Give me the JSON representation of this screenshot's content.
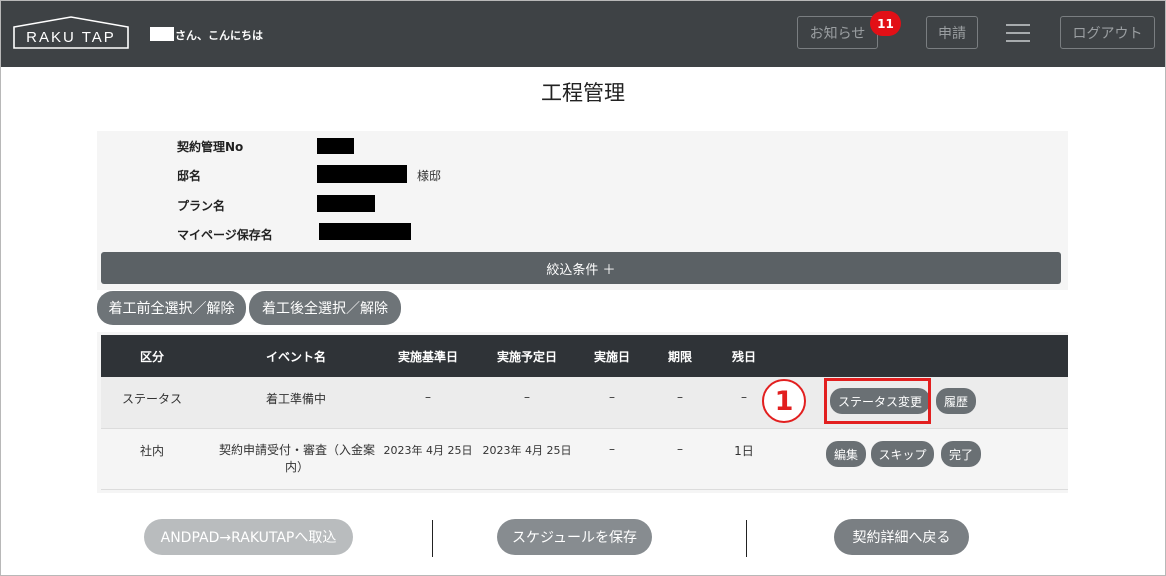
{
  "header": {
    "logo_text": "RAKU TAP",
    "greeting": "さん、こんにちは",
    "notice_label": "お知らせ",
    "notice_count": "11",
    "apply_label": "申請",
    "logout_label": "ログアウト"
  },
  "page_title": "工程管理",
  "info": {
    "contract_no_label": "契約管理No",
    "residence_label": "邸名",
    "residence_suffix": "様邸",
    "plan_label": "プラン名",
    "mypage_label": "マイページ保存名"
  },
  "filter": {
    "label": "絞込条件 ＋"
  },
  "select_buttons": {
    "before_label": "着工前全選択／解除",
    "after_label": "着工後全選択／解除"
  },
  "table": {
    "headers": [
      "区分",
      "イベント名",
      "実施基準日",
      "実施予定日",
      "実施日",
      "期限",
      "残日"
    ],
    "rows": [
      {
        "category": "ステータス",
        "event": "着工準備中",
        "base_date": "–",
        "planned_date": "–",
        "done_date": "–",
        "deadline": "–",
        "remaining": "–",
        "actions": [
          "ステータス変更",
          "履歴"
        ]
      },
      {
        "category": "社内",
        "event": "契約申請受付・審査（入金案内）",
        "base_date": "2023年 4月 25日",
        "planned_date": "2023年 4月 25日",
        "done_date": "–",
        "deadline": "–",
        "remaining": "1日",
        "actions": [
          "編集",
          "スキップ",
          "完了"
        ]
      }
    ]
  },
  "annotation": {
    "marker": "1"
  },
  "footer": {
    "import_label": "ANDPAD→RAKUTAPへ取込",
    "save_label": "スケジュールを保存",
    "back_label": "契約詳細へ戻る"
  },
  "colors": {
    "topbar": "#3e4245",
    "badge": "#e20f16",
    "highlight": "#e21f1f",
    "table_header": "#2f3337"
  }
}
